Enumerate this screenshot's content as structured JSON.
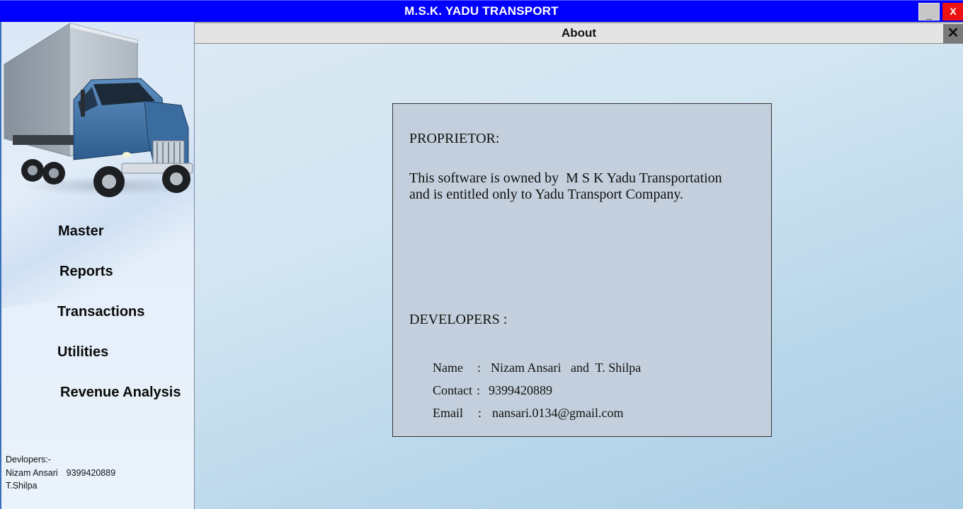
{
  "window": {
    "title": "M.S.K. YADU TRANSPORT",
    "minimize_label": "_",
    "close_label": "X"
  },
  "sidebar": {
    "menu": [
      {
        "label": "Master"
      },
      {
        "label": "Reports"
      },
      {
        "label": "Transactions"
      },
      {
        "label": "Utilities"
      },
      {
        "label": "Revenue Analysis"
      }
    ],
    "developers_note": {
      "heading": "Devlopers:-",
      "line1_name": "Nizam Ansari",
      "line1_phone": "9399420889",
      "line2_name": "T.Shilpa"
    },
    "truck_icon": "truck-image"
  },
  "panel": {
    "title": "About",
    "close_label": "✕"
  },
  "about": {
    "proprietor_heading": "PROPRIETOR:",
    "proprietor_line1": "This software is owned by  M S K Yadu Transportation",
    "proprietor_line2": "and is entitled only to Yadu Transport Company.",
    "developers_heading": "DEVELOPERS :",
    "name_key": "Name",
    "name_value": "Nizam Ansari   and  T. Shilpa",
    "contact_key": "Contact",
    "contact_value": "9399420889",
    "email_key": "Email",
    "email_value": "nansari.0134@gmail.com",
    "separator": ":"
  },
  "colors": {
    "titlebar": "#0000ff",
    "close_button": "#ee1111",
    "about_box": "#c3cfdc"
  }
}
